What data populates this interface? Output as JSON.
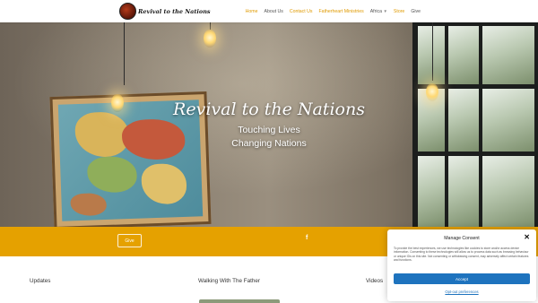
{
  "header": {
    "logo_text": "Revival to the Nations",
    "nav": [
      {
        "label": "Home",
        "active": true
      },
      {
        "label": "About Us",
        "active": false
      },
      {
        "label": "Contact Us",
        "active": true
      },
      {
        "label": "Fatherheart Ministries",
        "active": true
      },
      {
        "label": "Africa",
        "active": false,
        "dropdown": true
      },
      {
        "label": "Store",
        "active": true
      },
      {
        "label": "Give",
        "active": false
      }
    ]
  },
  "hero": {
    "title": "Revival to the Nations",
    "line1": "Touching Lives",
    "line2": "Changing Nations"
  },
  "band": {
    "button_label": "Give",
    "social_icon": "facebook-icon"
  },
  "columns": [
    {
      "title": "Updates"
    },
    {
      "title": "Walking With The Father"
    },
    {
      "title": "Videos"
    }
  ],
  "consent": {
    "title": "Manage Consent",
    "body": "To provide the best experiences, we use technologies like cookies to store and/or access device information. Consenting to these technologies will allow us to process data such as browsing behaviour or unique IDs on this site. Not consenting or withdrawing consent, may adversely affect certain features and functions.",
    "accept_label": "Accept",
    "deny_label": "Opt-out preferences"
  },
  "colors": {
    "accent": "#e09a00",
    "band": "#e5a100",
    "consent_button": "#1e73be"
  }
}
